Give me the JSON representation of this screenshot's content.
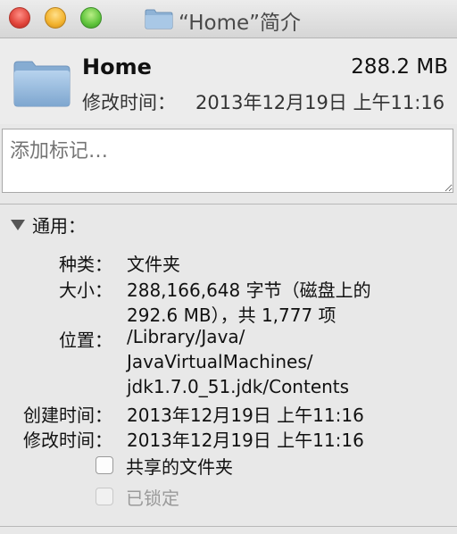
{
  "window": {
    "title": "“Home”简介",
    "controls": {
      "close": "#e0443a",
      "minimize": "#f2b22d",
      "zoom": "#5ec33b"
    }
  },
  "header": {
    "icon": "folder-icon",
    "name": "Home",
    "size": "288.2 MB",
    "modified_label": "修改时间：",
    "modified_value": "2013年12月19日 上午11:16"
  },
  "tags": {
    "placeholder": "添加标记…"
  },
  "general": {
    "title": "通用：",
    "kind_label": "种类：",
    "kind_value": "文件夹",
    "size_label": "大小：",
    "size_line1": "288,166,648 字节（磁盘上的",
    "size_line2": "292.6 MB），共 1,777 项",
    "where_label": "位置：",
    "where_line1": "/Library/Java/",
    "where_line2": "JavaVirtualMachines/",
    "where_line3": "jdk1.7.0_51.jdk/Contents",
    "created_label": "创建时间：",
    "created_value": "2013年12月19日 上午11:16",
    "modified_label": "修改时间：",
    "modified_value": "2013年12月19日 上午11:16",
    "shared_label": "共享的文件夹",
    "shared_checked": false,
    "locked_label": "已锁定",
    "locked_checked": false
  }
}
